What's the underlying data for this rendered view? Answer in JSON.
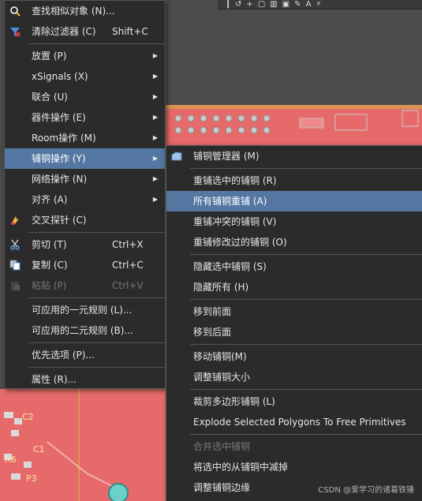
{
  "toolbar": {
    "icons": [
      "pin-icon",
      "route-icon",
      "plus-icon",
      "rect-select-icon",
      "bar-chart-icon",
      "chip-icon",
      "pencil-icon",
      "text-a-icon",
      "interactive-icon"
    ],
    "glyphs": [
      "┃",
      "↺",
      "+",
      "▢",
      "▥",
      "▣",
      "✎",
      "A",
      "⚡"
    ]
  },
  "watermark": "CSDN @爱学习的诸葛铁锤",
  "board_labels": {
    "c2": "C2",
    "c1": "C1",
    "r6": "R6",
    "p3": "P3"
  },
  "main_menu": {
    "items": [
      {
        "label": "查找相似对象 (N)...",
        "shortcut": "",
        "submenu": false,
        "icon": "search-icon",
        "disabled": false,
        "highlighted": false
      },
      {
        "label": "清除过滤器 (C)",
        "shortcut": "Shift+C",
        "submenu": false,
        "icon": "clear-filter-icon",
        "disabled": false,
        "highlighted": false
      },
      {
        "separator": true
      },
      {
        "label": "放置 (P)",
        "shortcut": "",
        "submenu": true,
        "icon": "",
        "disabled": false,
        "highlighted": false
      },
      {
        "label": "xSignals (X)",
        "shortcut": "",
        "submenu": true,
        "icon": "",
        "disabled": false,
        "highlighted": false
      },
      {
        "label": "联合 (U)",
        "shortcut": "",
        "submenu": true,
        "icon": "",
        "disabled": false,
        "highlighted": false
      },
      {
        "label": "器件操作 (E)",
        "shortcut": "",
        "submenu": true,
        "icon": "",
        "disabled": false,
        "highlighted": false
      },
      {
        "label": "Room操作 (M)",
        "shortcut": "",
        "submenu": true,
        "icon": "",
        "disabled": false,
        "highlighted": false
      },
      {
        "label": "铺铜操作 (Y)",
        "shortcut": "",
        "submenu": true,
        "icon": "",
        "disabled": false,
        "highlighted": true
      },
      {
        "label": "网络操作 (N)",
        "shortcut": "",
        "submenu": true,
        "icon": "",
        "disabled": false,
        "highlighted": false
      },
      {
        "label": "对齐 (A)",
        "shortcut": "",
        "submenu": true,
        "icon": "",
        "disabled": false,
        "highlighted": false
      },
      {
        "label": "交叉探针 (C)",
        "shortcut": "",
        "submenu": false,
        "icon": "cross-probe-icon",
        "disabled": false,
        "highlighted": false
      },
      {
        "separator": true
      },
      {
        "label": "剪切 (T)",
        "shortcut": "Ctrl+X",
        "submenu": false,
        "icon": "scissors-icon",
        "disabled": false,
        "highlighted": false
      },
      {
        "label": "复制 (C)",
        "shortcut": "Ctrl+C",
        "submenu": false,
        "icon": "copy-icon",
        "disabled": false,
        "highlighted": false
      },
      {
        "label": "粘贴 (P)",
        "shortcut": "Ctrl+V",
        "submenu": false,
        "icon": "paste-icon",
        "disabled": true,
        "highlighted": false
      },
      {
        "separator": true
      },
      {
        "label": "可应用的一元规则 (L)...",
        "shortcut": "",
        "submenu": false,
        "icon": "",
        "disabled": false,
        "highlighted": false
      },
      {
        "label": "可应用的二元规则 (B)...",
        "shortcut": "",
        "submenu": false,
        "icon": "",
        "disabled": false,
        "highlighted": false
      },
      {
        "separator": true
      },
      {
        "label": "优先选项 (P)...",
        "shortcut": "",
        "submenu": false,
        "icon": "",
        "disabled": false,
        "highlighted": false
      },
      {
        "separator": true
      },
      {
        "label": "属性 (R)...",
        "shortcut": "",
        "submenu": false,
        "icon": "",
        "disabled": false,
        "highlighted": false
      }
    ]
  },
  "sub_menu": {
    "items": [
      {
        "label": "铺铜管理器 (M)",
        "icon": "polygon-manager-icon",
        "disabled": false,
        "highlighted": false
      },
      {
        "separator": true
      },
      {
        "label": "重铺选中的铺铜 (R)",
        "icon": "",
        "disabled": false,
        "highlighted": false
      },
      {
        "label": "所有铺铜重铺 (A)",
        "icon": "",
        "disabled": false,
        "highlighted": true
      },
      {
        "label": "重铺冲突的铺铜 (V)",
        "icon": "",
        "disabled": false,
        "highlighted": false
      },
      {
        "label": "重铺修改过的铺铜 (O)",
        "icon": "",
        "disabled": false,
        "highlighted": false
      },
      {
        "separator": true
      },
      {
        "label": "隐藏选中铺铜 (S)",
        "icon": "",
        "disabled": false,
        "highlighted": false
      },
      {
        "label": "隐藏所有 (H)",
        "icon": "",
        "disabled": false,
        "highlighted": false
      },
      {
        "separator": true
      },
      {
        "label": "移到前面",
        "icon": "",
        "disabled": false,
        "highlighted": false
      },
      {
        "label": "移到后面",
        "icon": "",
        "disabled": false,
        "highlighted": false
      },
      {
        "separator": true
      },
      {
        "label": "移动铺铜(M)",
        "icon": "",
        "disabled": false,
        "highlighted": false
      },
      {
        "label": "调整铺铜大小",
        "icon": "",
        "disabled": false,
        "highlighted": false
      },
      {
        "separator": true
      },
      {
        "label": "裁剪多边形铺铜 (L)",
        "icon": "",
        "disabled": false,
        "highlighted": false
      },
      {
        "label": "Explode Selected Polygons To Free Primitives",
        "icon": "",
        "disabled": false,
        "highlighted": false
      },
      {
        "separator": true
      },
      {
        "label": "合并选中铺铜",
        "icon": "",
        "disabled": true,
        "highlighted": false
      },
      {
        "label": "将选中的从铺铜中减掉",
        "icon": "",
        "disabled": false,
        "highlighted": false
      },
      {
        "label": "调整铺铜边缘",
        "icon": "",
        "disabled": false,
        "highlighted": false
      }
    ]
  },
  "colors": {
    "menu_bg": "#2b2b2b",
    "highlight": "#5477a2",
    "pcb_copper": "#e76a6a",
    "pcb_dark": "#4d4b4c",
    "disabled_text": "#777777"
  }
}
